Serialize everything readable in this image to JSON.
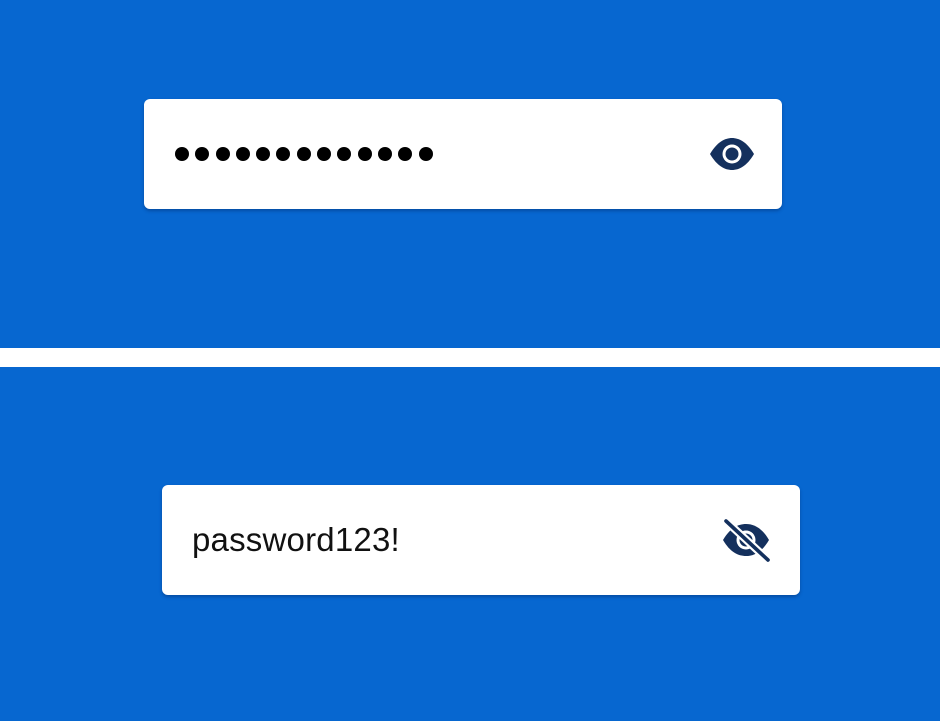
{
  "states": [
    {
      "visibility": "hidden",
      "masked_dot_count": 13,
      "toggle_icon": "eye-icon"
    },
    {
      "visibility": "visible",
      "value": "password123!",
      "toggle_icon": "eye-off-icon"
    }
  ],
  "colors": {
    "background": "#0767d0",
    "field": "#ffffff",
    "icon": "#14305d",
    "text": "#111111"
  }
}
